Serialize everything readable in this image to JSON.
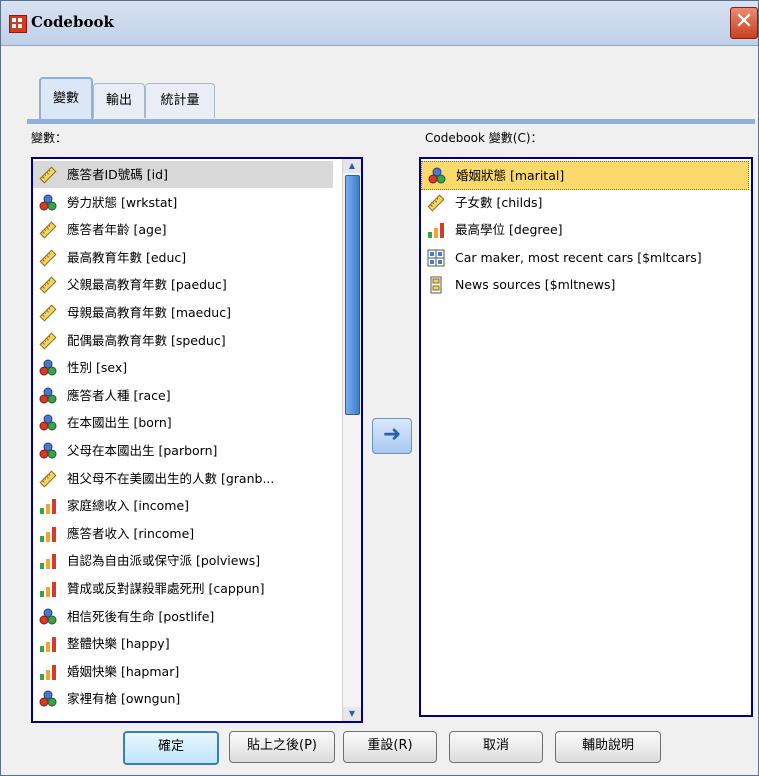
{
  "window": {
    "title": "Codebook",
    "close_glyph": "✕"
  },
  "tabs": [
    {
      "label": "變數",
      "active": true
    },
    {
      "label": "輸出",
      "active": false
    },
    {
      "label": "統計量",
      "active": false
    }
  ],
  "left": {
    "label": "變數：",
    "items": [
      {
        "icon": "scale-icon",
        "text": "應答者ID號碼 [id]"
      },
      {
        "icon": "nominal-icon",
        "text": "勞力狀態 [wrkstat]"
      },
      {
        "icon": "scale-icon",
        "text": "應答者年齡 [age]"
      },
      {
        "icon": "scale-icon",
        "text": "最高教育年數 [educ]"
      },
      {
        "icon": "scale-icon",
        "text": "父親最高教育年數 [paeduc]"
      },
      {
        "icon": "scale-icon",
        "text": "母親最高教育年數 [maeduc]"
      },
      {
        "icon": "scale-icon",
        "text": "配偶最高教育年數 [speduc]"
      },
      {
        "icon": "nominal-icon",
        "text": "性別 [sex]"
      },
      {
        "icon": "nominal-icon",
        "text": "應答者人種 [race]"
      },
      {
        "icon": "nominal-icon",
        "text": "在本國出生 [born]"
      },
      {
        "icon": "nominal-icon",
        "text": "父母在本國出生 [parborn]"
      },
      {
        "icon": "scale-icon",
        "text": "祖父母不在美國出生的人數 [granb..."
      },
      {
        "icon": "ordinal-icon",
        "text": "家庭總收入 [income]"
      },
      {
        "icon": "ordinal-icon",
        "text": "應答者收入 [rincome]"
      },
      {
        "icon": "ordinal-icon",
        "text": "自認為自由派或保守派 [polviews]"
      },
      {
        "icon": "ordinal-icon",
        "text": "贊成或反對謀殺罪處死刑 [cappun]"
      },
      {
        "icon": "nominal-icon",
        "text": "相信死後有生命 [postlife]"
      },
      {
        "icon": "ordinal-icon",
        "text": "整體快樂 [happy]"
      },
      {
        "icon": "ordinal-icon",
        "text": "婚姻快樂 [hapmar]"
      },
      {
        "icon": "nominal-icon",
        "text": "家裡有槍 [owngun]"
      }
    ]
  },
  "right": {
    "label": "Codebook 變數(C)：",
    "items": [
      {
        "icon": "nominal-icon",
        "text": "婚姻狀態 [marital]"
      },
      {
        "icon": "scale-icon",
        "text": "子女數 [childs]"
      },
      {
        "icon": "ordinal-icon",
        "text": "最高學位 [degree]"
      },
      {
        "icon": "multiple-dichotomy-set-icon",
        "text": "Car maker, most recent cars [$mltcars]"
      },
      {
        "icon": "multiple-category-set-icon",
        "text": "News sources [$mltnews]"
      }
    ]
  },
  "move_button": {
    "glyph": "➜"
  },
  "buttons": {
    "ok": "確定",
    "paste": "貼上之後(P)",
    "reset": "重設(R)",
    "cancel": "取消",
    "help": "輔助說明"
  },
  "scrollbar": {
    "up_glyph": "▲",
    "down_glyph": "▼"
  }
}
